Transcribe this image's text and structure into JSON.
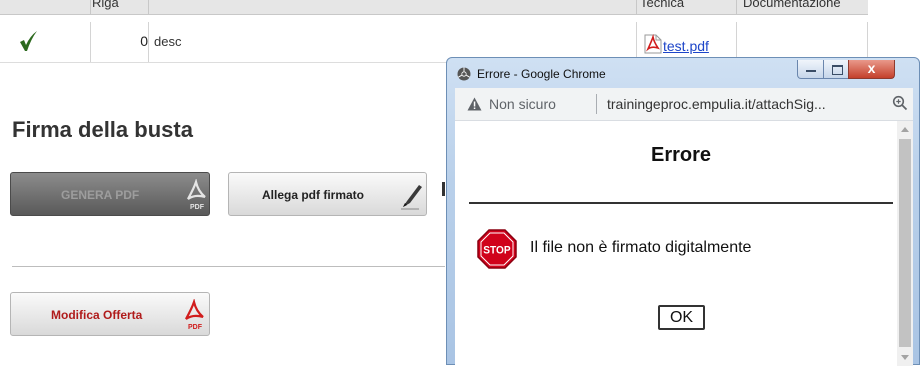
{
  "table": {
    "headers": [
      "Riga",
      "Tecnica",
      "Documentazione"
    ],
    "row": {
      "status": "check-icon",
      "number": "0",
      "description": "desc",
      "file": "test.pdf"
    }
  },
  "section": {
    "title": "Firma della busta"
  },
  "buttons": {
    "genera_pdf": "GENERA PDF",
    "allega_pdf": "Allega pdf firmato",
    "modifica_offerta": "Modifica Offerta"
  },
  "popup": {
    "window_title": "Errore - Google Chrome",
    "security_label": "Non sicuro",
    "url": "trainingeproc.empulia.it/attachSig...",
    "dialog_title": "Errore",
    "stop_label": "STOP",
    "message": "Il file non è firmato digitalmente",
    "ok_label": "OK",
    "close_glyph": "x"
  },
  "colors": {
    "link": "#1d45c9",
    "modifica_text": "#b01b1b",
    "stop_red": "#d0021b",
    "check_green": "#2d6a1f"
  }
}
